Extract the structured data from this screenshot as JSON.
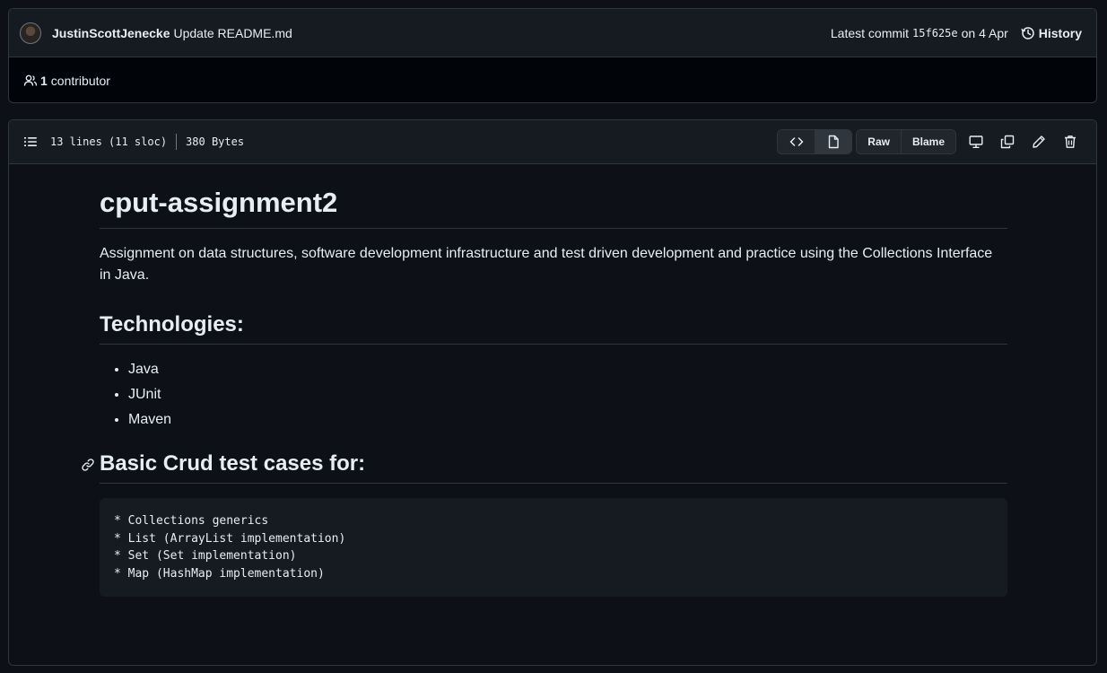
{
  "commit": {
    "author": "JustinScottJenecke",
    "message": "Update README.md",
    "latest_label": "Latest commit",
    "sha": "15f625e",
    "date": "on 4 Apr",
    "history_label": "History",
    "contributors_count": "1",
    "contributors_label": "contributor"
  },
  "file": {
    "lines": "13 lines (11 sloc)",
    "size": "380 Bytes",
    "raw_label": "Raw",
    "blame_label": "Blame"
  },
  "readme": {
    "title": "cput-assignment2",
    "description": "Assignment on data structures, software development infrastructure and test driven development and practice using the Collections Interface in Java.",
    "technologies_heading": "Technologies:",
    "technologies": [
      "Java",
      "JUnit",
      "Maven"
    ],
    "tests_heading": "Basic Crud test cases for:",
    "code_lines": [
      "* Collections generics",
      "* List (ArrayList implementation)",
      "* Set (Set implementation)",
      "* Map (HashMap implementation)"
    ]
  },
  "icons": {
    "avatar": "avatar",
    "history": "history-icon",
    "people": "people-icon",
    "toc": "list-unordered-icon",
    "code": "code-icon",
    "file": "file-icon",
    "desktop": "desktop-icon",
    "copy": "copy-icon",
    "pencil": "pencil-icon",
    "trash": "trash-icon",
    "link": "link-icon"
  }
}
